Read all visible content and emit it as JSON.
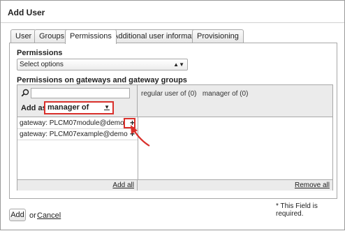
{
  "dialog": {
    "title": "Add User"
  },
  "tabs": [
    {
      "label": "User"
    },
    {
      "label": "Groups"
    },
    {
      "label": "Permissions"
    },
    {
      "label": "Additional user information"
    },
    {
      "label": "Provisioning"
    }
  ],
  "permissions": {
    "section_label": "Permissions",
    "select_value": "Select options"
  },
  "gateways": {
    "section_label": "Permissions on gateways and gateway groups",
    "search_value": "",
    "add_as_label": "Add as",
    "add_as_value": "manager of",
    "regular_user_label": "regular user of",
    "regular_user_count": "(0)",
    "manager_label": "manager of",
    "manager_count": "(0)",
    "items": [
      {
        "label": "gateway: PLCM07module@demo",
        "action": "+"
      },
      {
        "label": "gateway: PLCM07example@demo",
        "action": "+"
      }
    ],
    "add_all": "Add all",
    "remove_all": "Remove all"
  },
  "footer": {
    "required_note": "* This Field is required.",
    "add_button": "Add",
    "or_text": "or",
    "cancel_link": "Cancel"
  },
  "colors": {
    "highlight": "#d9302b",
    "header_bg": "#ebebeb",
    "border": "#a8a8a8"
  },
  "icons": {
    "search": "magnifier-icon",
    "add": "plus-icon",
    "select": "up-down-arrow-icon"
  }
}
